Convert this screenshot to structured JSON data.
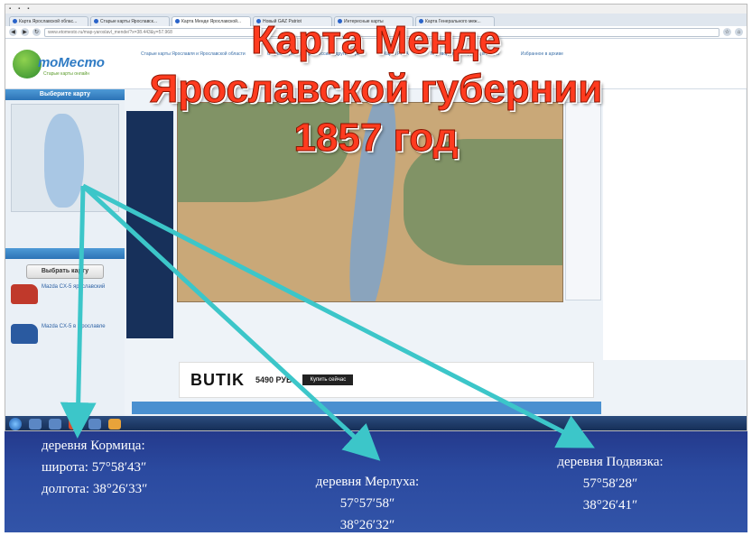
{
  "overlay": {
    "title_line1": "Карта Менде",
    "title_line2": "Ярославской губернии",
    "title_line3": "1857 год"
  },
  "browser": {
    "tabs": [
      {
        "label": "Карта Ярославской облас..."
      },
      {
        "label": "Старые карты Ярославск..."
      },
      {
        "label": "Карта Менде Ярославской..."
      },
      {
        "label": "Новый GAZ Patriot"
      },
      {
        "label": "Интересные карты"
      },
      {
        "label": "Карта Генерального меж..."
      }
    ],
    "address": "www.etomesto.ru/map-yaroslavl_mende/?x=38.443&y=57.968"
  },
  "site": {
    "logo_text": "тоМесто",
    "logo_sub": "Старые карты онлайн",
    "top_links": [
      "Старые карты Ярославля и Ярославской области",
      "Старые карты городов России и других стран",
      "Карта РККА",
      "Перевод старых единиц в метры",
      "Избранное в архиве"
    ],
    "sidebar_header": "Выберите карту",
    "select_button": "Выбрать карту",
    "ad_title_1": "Mazda CX-5 ярославский",
    "ad_title_2": "Mazda CX-5 в Ярославле",
    "butik_brand": "BUTIK",
    "butik_price": "5490 РУБ",
    "butik_buy": "Купить сейчас"
  },
  "locations": [
    {
      "name": "деревня Кормица:",
      "lat": "широта: 57°58′43″",
      "lon": "долгота: 38°26′33″"
    },
    {
      "name": "деревня Мерлуха:",
      "lat": "57°57′58″",
      "lon": "38°26′32″"
    },
    {
      "name": "деревня Подвязка:",
      "lat": "57°58′28″",
      "lon": "38°26′41″"
    }
  ],
  "colors": {
    "title": "#ff3b1f",
    "arrows": "#3cc6c9",
    "background_sea": "#2b4aa0"
  }
}
